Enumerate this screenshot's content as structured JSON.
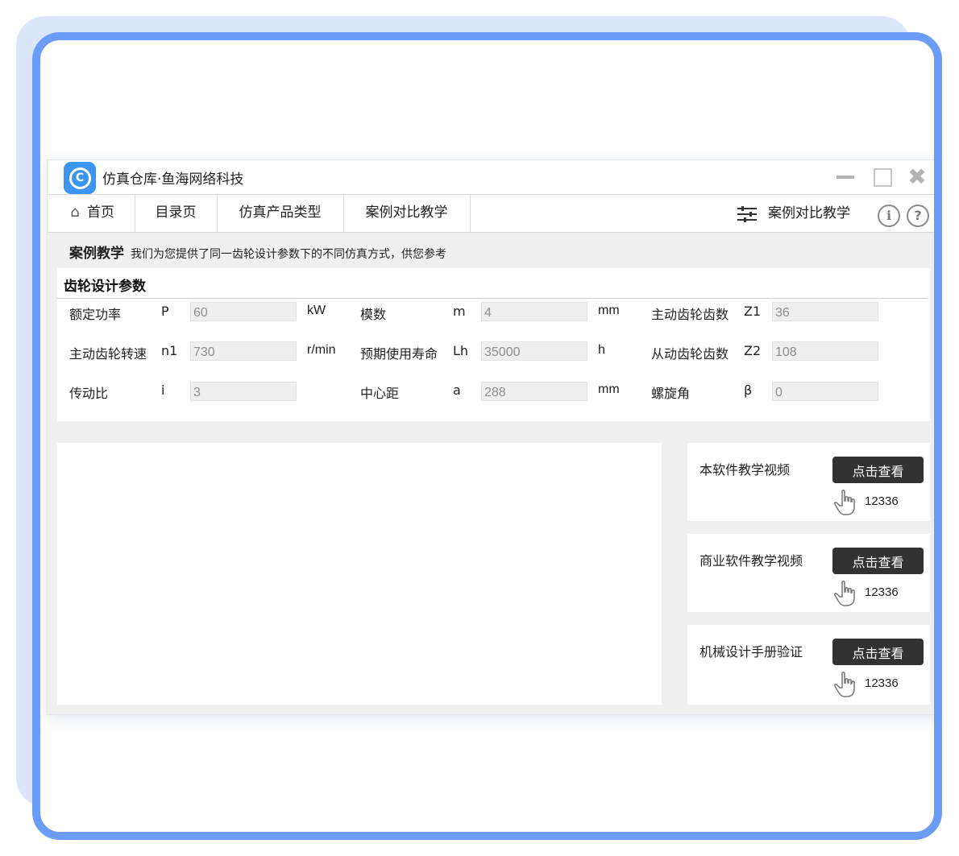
{
  "window": {
    "title": "仿真仓库·鱼海网络科技",
    "logo_letter": "C"
  },
  "nav": {
    "home": "首页",
    "catalog": "目录页",
    "product_types": "仿真产品类型",
    "case_teaching": "案例对比教学",
    "right_label": "案例对比教学"
  },
  "banner": {
    "title": "案例教学",
    "text": "我们为您提供了同一齿轮设计参数下的不同仿真方式，供您参考"
  },
  "params": {
    "title": "齿轮设计参数",
    "rows": [
      [
        {
          "label": "额定功率",
          "symbol": "P",
          "value": "60",
          "unit": "kW"
        },
        {
          "label": "模数",
          "symbol": "m",
          "value": "4",
          "unit": "mm"
        },
        {
          "label": "主动齿轮齿数",
          "symbol": "Z1",
          "value": "36",
          "unit": ""
        }
      ],
      [
        {
          "label": "主动齿轮转速",
          "symbol": "n1",
          "value": "730",
          "unit": "r/min"
        },
        {
          "label": "预期使用寿命",
          "symbol": "Lh",
          "value": "35000",
          "unit": "h"
        },
        {
          "label": "从动齿轮齿数",
          "symbol": "Z2",
          "value": "108",
          "unit": ""
        }
      ],
      [
        {
          "label": "传动比",
          "symbol": "i",
          "value": "3",
          "unit": ""
        },
        {
          "label": "中心距",
          "symbol": "a",
          "value": "288",
          "unit": "mm"
        },
        {
          "label": "螺旋角",
          "symbol": "β",
          "value": "0",
          "unit": ""
        }
      ]
    ]
  },
  "side_cards": [
    {
      "label": "本软件教学视频",
      "button": "点击查看",
      "count": "12336"
    },
    {
      "label": "商业软件教学视频",
      "button": "点击查看",
      "count": "12336"
    },
    {
      "label": "机械设计手册验证",
      "button": "点击查看",
      "count": "12336"
    }
  ],
  "colors": {
    "frame_border": "#6b9cf7",
    "frame_back": "#dbe6fb",
    "logo": "#3b96f1",
    "button_bg": "#323232"
  }
}
